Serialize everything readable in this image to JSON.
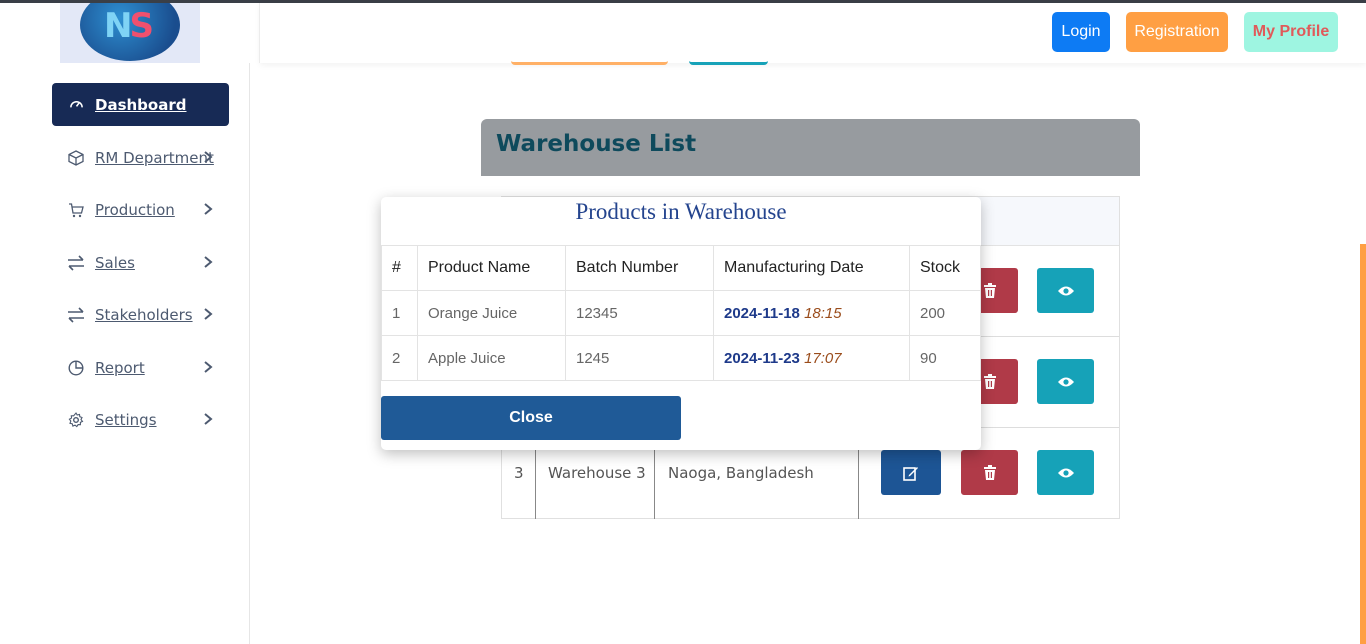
{
  "header": {
    "logo_text": "NS",
    "login_label": "Login",
    "registration_label": "Registration",
    "profile_label": "My Profile"
  },
  "sidebar": {
    "items": [
      {
        "label": "Dashboard",
        "icon": "gauge-icon",
        "active": true
      },
      {
        "label": "RM Department",
        "icon": "box-icon"
      },
      {
        "label": "Production",
        "icon": "cart-icon"
      },
      {
        "label": "Sales",
        "icon": "exchange-icon"
      },
      {
        "label": "Stakeholders",
        "icon": "exchange-icon"
      },
      {
        "label": "Report",
        "icon": "pie-chart-icon"
      },
      {
        "label": "Settings",
        "icon": "gear-icon"
      }
    ]
  },
  "warehouse": {
    "title": "Warehouse List",
    "rows": [
      {
        "index": "3",
        "name": "Warehouse 3",
        "location": "Naoga, Bangladesh"
      }
    ]
  },
  "modal": {
    "title": "Products in Warehouse",
    "columns": [
      "#",
      "Product Name",
      "Batch Number",
      "Manufacturing Date",
      "Stock"
    ],
    "rows": [
      {
        "index": "1",
        "product": "Orange Juice",
        "batch": "12345",
        "date": "2024-11-18",
        "time": "18:15",
        "stock": "200"
      },
      {
        "index": "2",
        "product": "Apple Juice",
        "batch": "1245",
        "date": "2024-11-23",
        "time": "17:07",
        "stock": "90"
      }
    ],
    "close_label": "Close"
  },
  "colors": {
    "sidebar_active": "#172a55",
    "login": "#0d7bf4",
    "registration": "#ff9f43",
    "profile": "#9ef5e1",
    "edit": "#1d5595",
    "delete": "#b03a48",
    "view": "#16a2b8"
  }
}
